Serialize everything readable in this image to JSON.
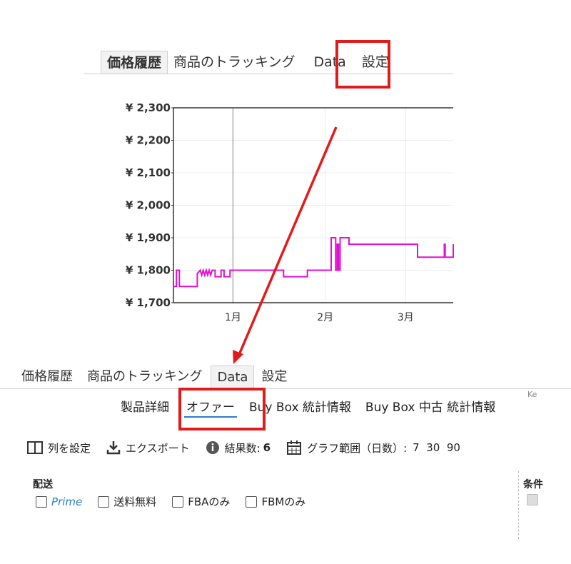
{
  "top_tabs": [
    "価格履歴",
    "商品のトラッキング",
    "Data",
    "設定"
  ],
  "bottom_tabs": [
    "価格履歴",
    "商品のトラッキング",
    "Data",
    "設定"
  ],
  "sub_tabs": [
    "製品詳細",
    "オファー",
    "Buy Box 統計情報",
    "Buy Box 中古 統計情報"
  ],
  "ke_label": "Ke",
  "toolbar": {
    "columns_label": "列を設定",
    "export_label": "エクスポート",
    "results_label": "結果数:",
    "results_count": "6",
    "range_label": "グラフ範囲（日数）:",
    "range_options": "7  30  90"
  },
  "filters": {
    "heading": "配送",
    "options": [
      "Prime",
      "送料無料",
      "FBAのみ",
      "FBMのみ"
    ]
  },
  "condition_heading": "条件",
  "colors": {
    "accent": "#2a7fc9",
    "highlight": "#e11b1b",
    "line": "#e30fd2"
  },
  "chart_data": {
    "type": "line",
    "y_tick_labels": [
      "¥ 2,300",
      "¥ 2,200",
      "¥ 2,100",
      "¥ 2,000",
      "¥ 1,900",
      "¥ 1,800",
      "¥ 1,700"
    ],
    "y_ticks": [
      2300,
      2200,
      2100,
      2000,
      1900,
      1800,
      1700
    ],
    "ylim": [
      1700,
      2300
    ],
    "x_tick_labels": [
      "1月",
      "2月",
      "3月"
    ],
    "x_ticks": [
      26,
      57,
      84
    ],
    "xlim": [
      6,
      100
    ],
    "series": [
      {
        "points": [
          [
            6,
            1750
          ],
          [
            7,
            1750
          ],
          [
            7,
            1800
          ],
          [
            8,
            1800
          ],
          [
            8,
            1750
          ],
          [
            14,
            1750
          ],
          [
            14,
            1790
          ],
          [
            15,
            1800
          ],
          [
            15.5,
            1785
          ],
          [
            16,
            1800
          ],
          [
            16.5,
            1785
          ],
          [
            17,
            1800
          ],
          [
            17.5,
            1785
          ],
          [
            18,
            1800
          ],
          [
            18.5,
            1785
          ],
          [
            19,
            1800
          ],
          [
            20,
            1800
          ],
          [
            20,
            1780
          ],
          [
            22,
            1780
          ],
          [
            22,
            1800
          ],
          [
            23,
            1800
          ],
          [
            23,
            1780
          ],
          [
            25,
            1780
          ],
          [
            25,
            1800
          ],
          [
            43,
            1800
          ],
          [
            43,
            1780
          ],
          [
            51,
            1780
          ],
          [
            51,
            1800
          ],
          [
            59,
            1800
          ],
          [
            59,
            1900
          ],
          [
            60.5,
            1900
          ],
          [
            60.5,
            1800
          ],
          [
            61,
            1800
          ],
          [
            61,
            1880
          ],
          [
            61.5,
            1880
          ],
          [
            61.5,
            1800
          ],
          [
            62,
            1800
          ],
          [
            62,
            1900
          ],
          [
            65,
            1900
          ],
          [
            65,
            1880
          ],
          [
            88,
            1880
          ],
          [
            88,
            1840
          ],
          [
            97,
            1840
          ],
          [
            97,
            1880
          ],
          [
            97.3,
            1880
          ],
          [
            97.3,
            1840
          ],
          [
            100,
            1840
          ],
          [
            100,
            1880
          ]
        ]
      }
    ]
  }
}
